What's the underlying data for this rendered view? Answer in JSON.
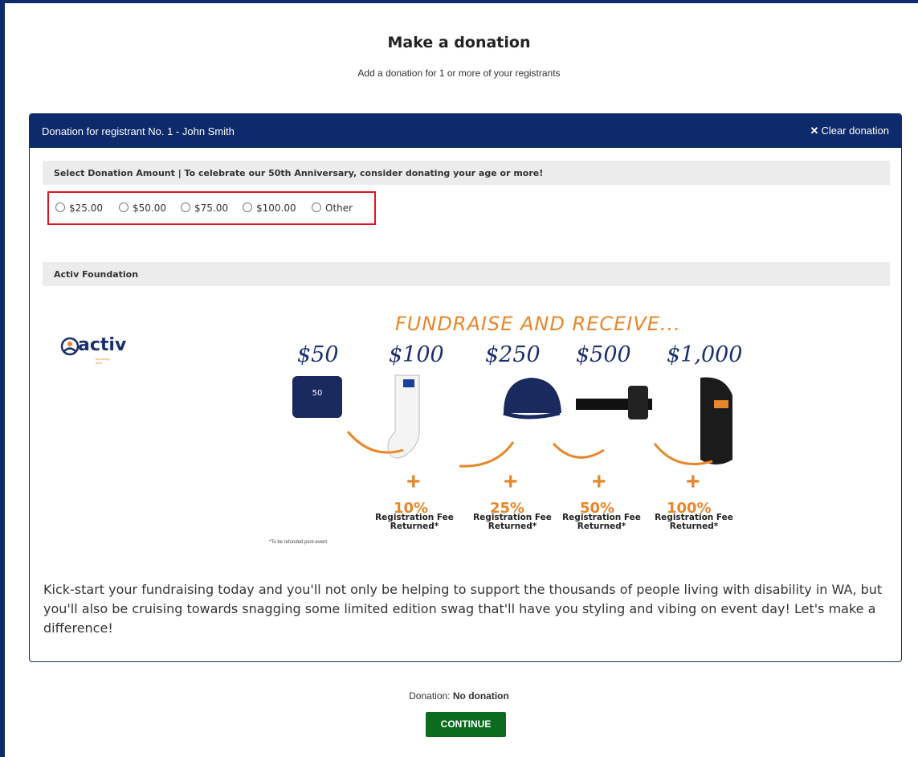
{
  "page": {
    "title": "Make a donation",
    "subtitle": "Add a donation for 1 or more of your registrants"
  },
  "panel": {
    "header_title": "Donation for registrant No. 1 - John Smith",
    "clear_label": "Clear donation",
    "clear_icon": "close-icon",
    "amount_section_label": "Select Donation Amount | To celebrate our 50th Anniversary, consider donating your age or more!",
    "amount_options": [
      "$25.00",
      "$50.00",
      "$75.00",
      "$100.00",
      "Other"
    ],
    "foundation_section_label": "Activ Foundation",
    "body_text": "Kick-start your fundraising today and you'll not only be helping to support the thousands of people living with disability in WA, but you'll also be cruising towards snagging some limited edition swag that'll have you styling and vibing on event day! Let's make a difference!"
  },
  "promo": {
    "logo_text": "activ",
    "logo_sub": "improving lives",
    "title": "FUNDRAISE AND RECEIVE...",
    "tiers": [
      {
        "price": "$50"
      },
      {
        "price": "$100",
        "plus": "+",
        "percent": "10%",
        "fee": "Registration Fee Returned*"
      },
      {
        "price": "$250",
        "plus": "+",
        "percent": "25%",
        "fee": "Registration Fee Returned*"
      },
      {
        "price": "$500",
        "plus": "+",
        "percent": "50%",
        "fee": "Registration Fee Returned*"
      },
      {
        "price": "$1,000",
        "plus": "+",
        "percent": "100%",
        "fee": "Registration Fee Returned*"
      }
    ],
    "refund_note": "*To be refunded post-event.",
    "colors": {
      "navy": "#1a2f6e",
      "orange": "#e8862a"
    }
  },
  "summary": {
    "label": "Donation:",
    "value": "No donation",
    "continue_label": "CONTINUE"
  }
}
